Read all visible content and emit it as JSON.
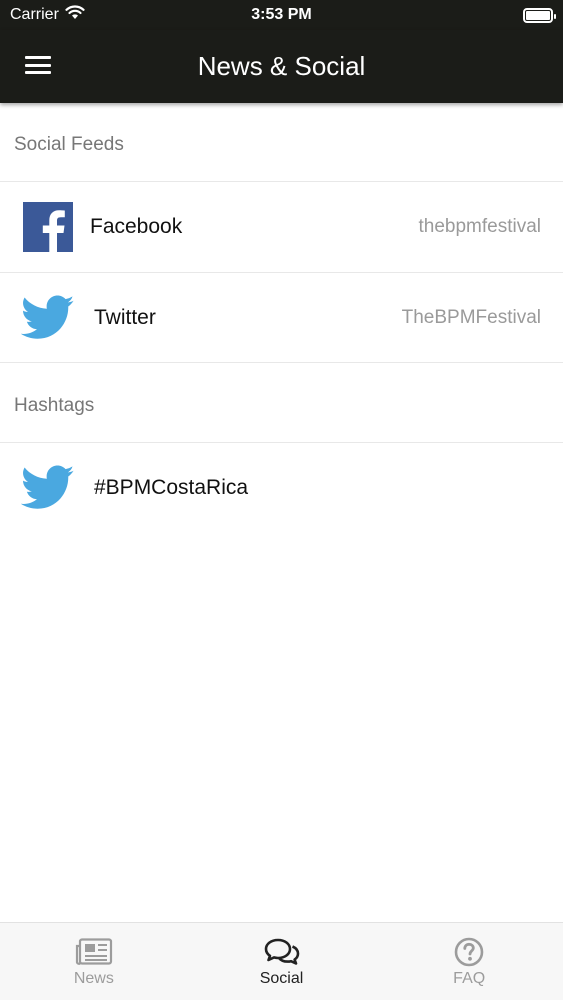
{
  "status_bar": {
    "carrier": "Carrier",
    "time": "3:53 PM"
  },
  "nav": {
    "title": "News & Social",
    "menu_icon": "hamburger-menu-icon"
  },
  "sections": {
    "social_feeds": {
      "header": "Social Feeds",
      "items": [
        {
          "icon": "facebook-icon",
          "label": "Facebook",
          "detail": "thebpmfestival"
        },
        {
          "icon": "twitter-icon",
          "label": "Twitter",
          "detail": "TheBPMFestival"
        }
      ]
    },
    "hashtags": {
      "header": "Hashtags",
      "items": [
        {
          "icon": "twitter-icon",
          "label": "#BPMCostaRica",
          "detail": ""
        }
      ]
    }
  },
  "tabs": [
    {
      "label": "News",
      "icon": "newspaper-icon",
      "active": false
    },
    {
      "label": "Social",
      "icon": "chat-bubbles-icon",
      "active": true
    },
    {
      "label": "FAQ",
      "icon": "question-circle-icon",
      "active": false
    }
  ],
  "colors": {
    "nav_background": "#1b1c18",
    "facebook_blue": "#3b5998",
    "twitter_blue": "#4aa8e0",
    "secondary_text": "#9a9a9a",
    "tab_inactive": "#9c9c9c",
    "tab_active": "#222222"
  }
}
